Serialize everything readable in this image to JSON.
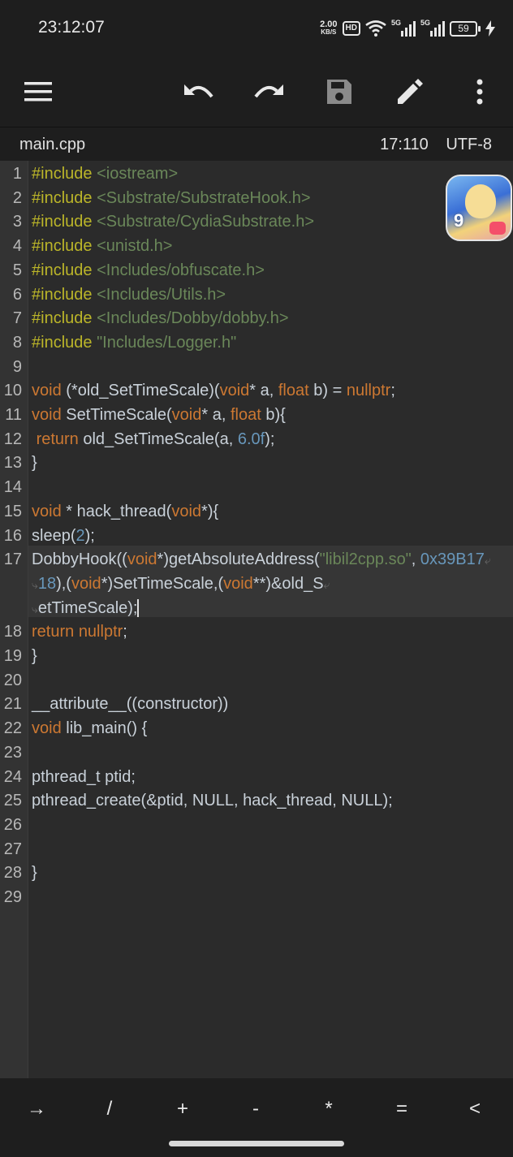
{
  "status": {
    "time": "23:12:07",
    "net_speed": "2.00",
    "net_unit": "KB/S",
    "hd_badge": "HD",
    "sim1": "5G",
    "sim2": "5G",
    "battery": "59"
  },
  "toolbar": {
    "menu_icon": "hamburger-menu-icon",
    "undo_icon": "undo-icon",
    "redo_icon": "redo-icon",
    "save_icon": "save-icon",
    "edit_icon": "pencil-icon",
    "more_icon": "more-vert-icon"
  },
  "file": {
    "name": "main.cpp",
    "cursor": "17:110",
    "encoding": "UTF-8"
  },
  "editor": {
    "line_numbers": [
      "1",
      "2",
      "3",
      "4",
      "5",
      "6",
      "7",
      "8",
      "9",
      "10",
      "11",
      "12",
      "13",
      "14",
      "15",
      "16",
      "17",
      "18",
      "19",
      "20",
      "21",
      "22",
      "23",
      "24",
      "25",
      "26",
      "27",
      "28",
      "29"
    ],
    "lines": [
      "#include <iostream>",
      "#include <Substrate/SubstrateHook.h>",
      "#include <Substrate/CydiaSubstrate.h>",
      "#include <unistd.h>",
      "#include <Includes/obfuscate.h>",
      "#include <Includes/Utils.h>",
      "#include <Includes/Dobby/dobby.h>",
      "#include \"Includes/Logger.h\"",
      "",
      "void (*old_SetTimeScale)(void* a, float b) = nullptr;",
      "void SetTimeScale(void* a, float b){",
      "  return old_SetTimeScale(a, 6.0f);",
      "}",
      "",
      "void * hack_thread(void*){",
      "sleep(2);",
      "DobbyHook((void*)getAbsoluteAddress(\"libil2cpp.so\", 0x39B1718),(void*)SetTimeScale,(void**)&old_SetTimeScale);",
      "return nullptr;",
      "}",
      "",
      "__attribute__((constructor))",
      "void lib_main() {",
      "",
      "pthread_t ptid;",
      "pthread_create(&ptid, NULL, hack_thread, NULL);",
      "",
      "",
      "}",
      ""
    ],
    "syntax_colors": {
      "keyword": "#cc7832",
      "string": "#6a8759",
      "include": "#bbb529",
      "number": "#6897bb"
    }
  },
  "overlay": {
    "app_icon": "floating-game-app-icon"
  },
  "keys": [
    "→",
    "/",
    "+",
    "-",
    "*",
    "=",
    "<"
  ]
}
